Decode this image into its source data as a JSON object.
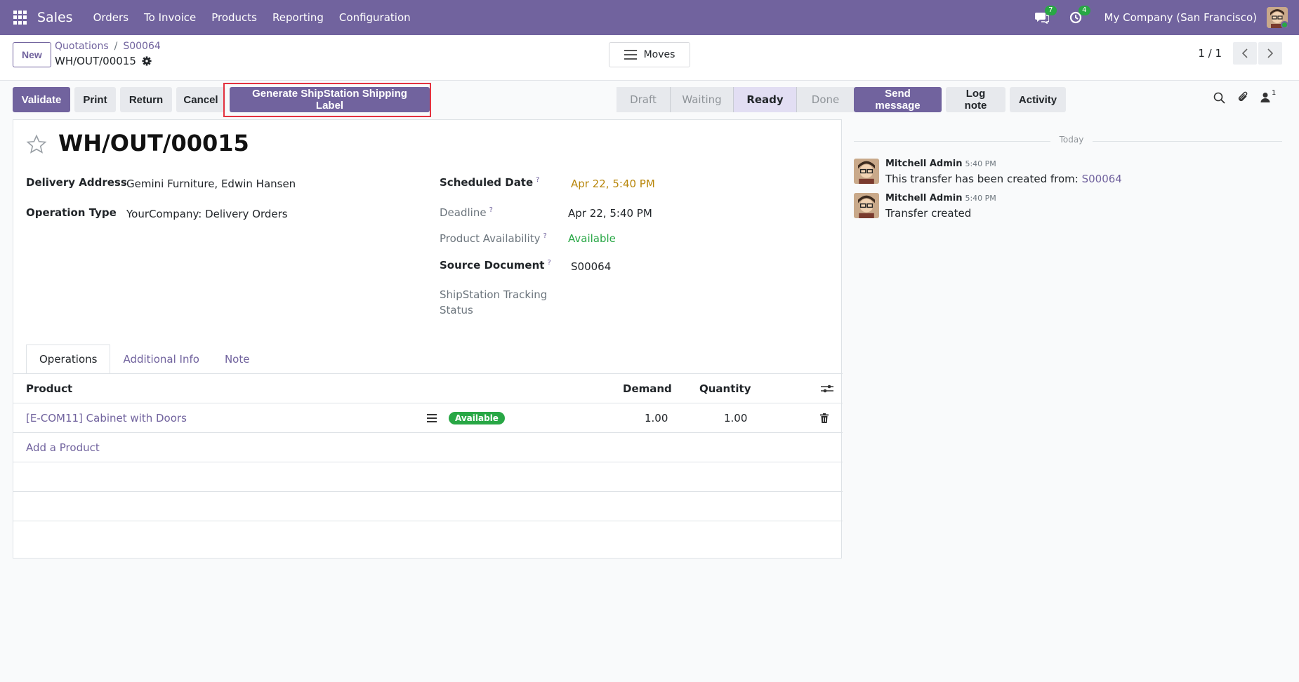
{
  "navbar": {
    "app_name": "Sales",
    "menu": [
      "Orders",
      "To Invoice",
      "Products",
      "Reporting",
      "Configuration"
    ],
    "messages_count": "7",
    "activities_count": "4",
    "company": "My Company (San Francisco)"
  },
  "control": {
    "new_label": "New",
    "breadcrumb": [
      "Quotations",
      "S00064"
    ],
    "record_name": "WH/OUT/00015",
    "moves_label": "Moves",
    "pager": "1 / 1"
  },
  "actions": {
    "validate": "Validate",
    "print": "Print",
    "return": "Return",
    "cancel": "Cancel",
    "shipstation": "Generate ShipStation Shipping Label"
  },
  "status_stages": [
    "Draft",
    "Waiting",
    "Ready",
    "Done"
  ],
  "active_stage": "Ready",
  "form": {
    "title": "WH/OUT/00015",
    "delivery_address_label": "Delivery Address",
    "delivery_address": "Gemini Furniture, Edwin Hansen",
    "operation_type_label": "Operation Type",
    "operation_type": "YourCompany: Delivery Orders",
    "scheduled_date_label": "Scheduled Date",
    "scheduled_date": "Apr 22, 5:40 PM",
    "deadline_label": "Deadline",
    "deadline": "Apr 22, 5:40 PM",
    "availability_label": "Product Availability",
    "availability": "Available",
    "source_label": "Source Document",
    "source": "S00064",
    "tracking_label_1": "ShipStation Tracking",
    "tracking_label_2": "Status",
    "help_mark": "?"
  },
  "tabs": [
    "Operations",
    "Additional Info",
    "Note"
  ],
  "table": {
    "headers": {
      "product": "Product",
      "demand": "Demand",
      "quantity": "Quantity"
    },
    "rows": [
      {
        "product": "[E-COM11] Cabinet with Doors",
        "status": "Available",
        "demand": "1.00",
        "quantity": "1.00"
      }
    ],
    "add_label": "Add a Product"
  },
  "chatter": {
    "send_message": "Send message",
    "log_note": "Log note",
    "activity": "Activity",
    "followers_count": "1",
    "date_separator": "Today",
    "messages": [
      {
        "author": "Mitchell Admin",
        "time": "5:40 PM",
        "text": "This transfer has been created from:",
        "link": "S00064"
      },
      {
        "author": "Mitchell Admin",
        "time": "5:40 PM",
        "text": "Transfer created",
        "link": ""
      }
    ]
  }
}
